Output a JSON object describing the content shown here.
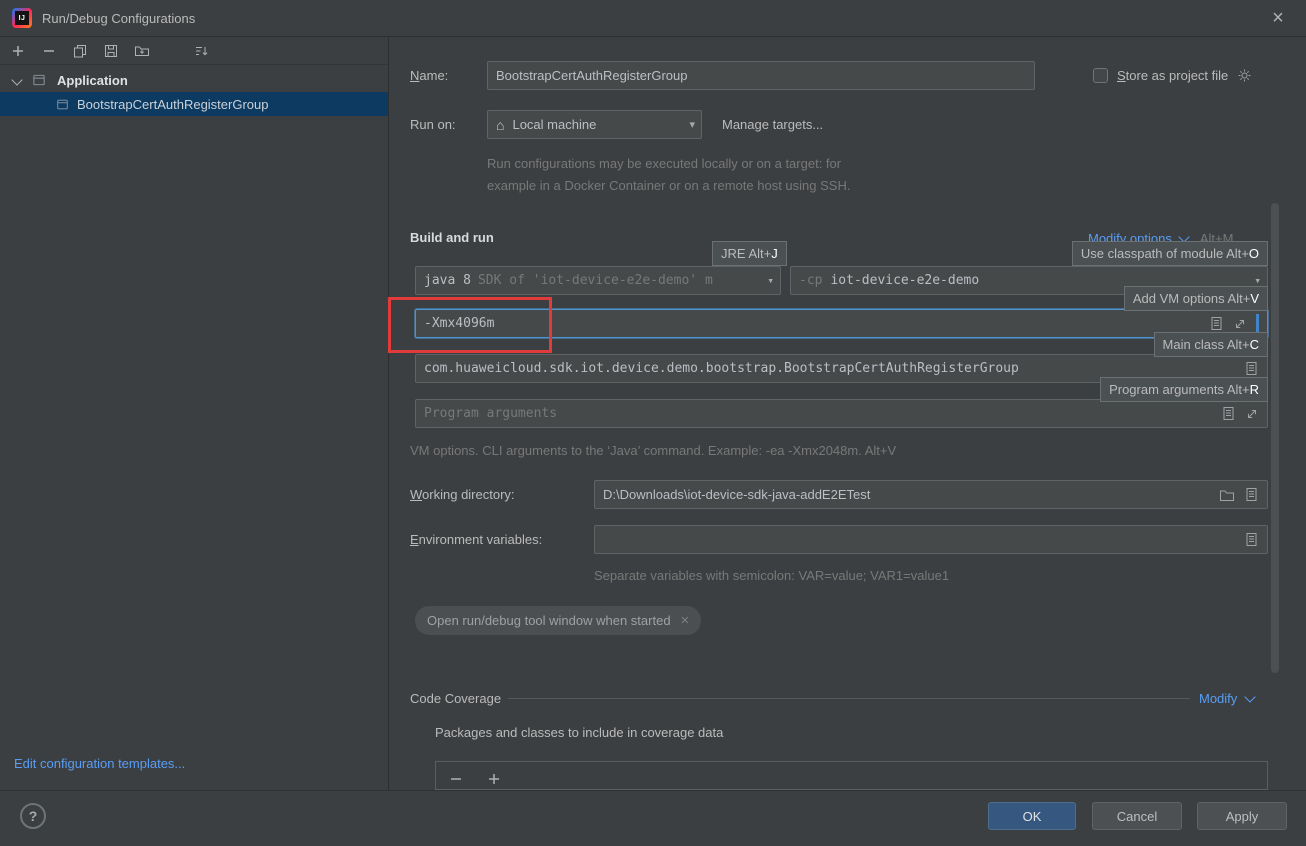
{
  "icons": {
    "dropdown_arrow": "▾",
    "home": "⌂",
    "close": "×",
    "chip_close": "×",
    "help": "?"
  },
  "titlebar": {
    "title": "Run/Debug Configurations"
  },
  "sidebar": {
    "tree": {
      "group": "Application",
      "selected_item": "BootstrapCertAuthRegisterGroup"
    },
    "edit_templates_link": "Edit configuration templates..."
  },
  "main": {
    "name": {
      "mn": "N",
      "rest": "ame:",
      "value": "BootstrapCertAuthRegisterGroup"
    },
    "store": {
      "mn": "S",
      "rest": "tore as project file"
    },
    "run_on": {
      "label": "Run on:",
      "value": "Local machine",
      "manage_link": "Manage targets...",
      "desc1": "Run configurations may be executed locally or on a target: for",
      "desc2": "example in a Docker Container or on a remote host using SSH."
    },
    "build": {
      "title": "Build and run",
      "modify_options": "Modify options",
      "modify_shortcut": "Alt+M",
      "jre_hint": {
        "text": "JRE Alt+",
        "key": "J"
      },
      "classpath_hint": {
        "text": "Use classpath of module Alt+",
        "key": "O"
      },
      "vm_hint": {
        "text": "Add VM options Alt+",
        "key": "V"
      },
      "main_class_hint": {
        "text": "Main class Alt+",
        "key": "C"
      },
      "program_args_hint": {
        "text": "Program arguments Alt+",
        "key": "R"
      },
      "jre_value": "java 8",
      "jre_detail": "SDK of 'iot-device-e2e-demo' m",
      "cp_flag": "-cp",
      "cp_value": "iot-device-e2e-demo",
      "vm_options": "-Xmx4096m",
      "main_class": "com.huaweicloud.sdk.iot.device.demo.bootstrap.BootstrapCertAuthRegisterGroup",
      "program_args_placeholder": "Program arguments",
      "vm_help": "VM options. CLI arguments to the ‘Java’ command. Example: -ea -Xmx2048m. Alt+V"
    },
    "working_dir": {
      "mn": "W",
      "rest": "orking directory:",
      "value": "D:\\Downloads\\iot-device-sdk-java-addE2ETest"
    },
    "env": {
      "mn": "E",
      "rest": "nvironment variables:",
      "help": "Separate variables with semicolon: VAR=value; VAR1=value1"
    },
    "chip_label": "Open run/debug tool window when started",
    "coverage": {
      "title": "Code Coverage",
      "modify": "Modify",
      "desc": "Packages and classes to include in coverage data"
    }
  },
  "footer": {
    "ok": "OK",
    "cancel": "Cancel",
    "apply": "Apply"
  }
}
